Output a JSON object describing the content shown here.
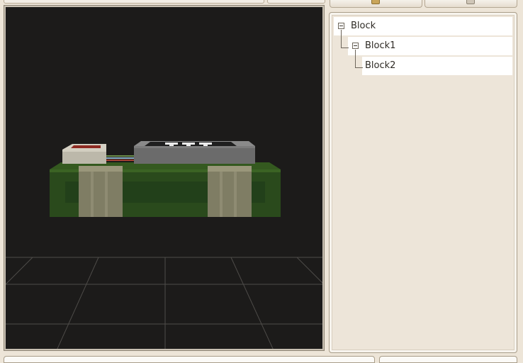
{
  "colors": {
    "window_bg": "#ede5d8",
    "viewport_bg": "#1c1b1a",
    "tree_row_bg": "#ffffff",
    "grid_line": "#5b5955",
    "block_green": "#2b4a1d",
    "strap_beige": "#8a8670",
    "box_grey": "#6d6d6d"
  },
  "toolbar": {
    "add_button_icon": "add-block-icon",
    "remove_button_icon": "remove-block-icon"
  },
  "viewport": {
    "grid": true,
    "model": "block-assembly"
  },
  "tree": {
    "nodes": [
      {
        "label": "Block",
        "expanded": true,
        "depth": 0
      },
      {
        "label": "Block1",
        "expanded": true,
        "depth": 1
      },
      {
        "label": "Block2",
        "expanded": false,
        "depth": 2
      }
    ]
  }
}
